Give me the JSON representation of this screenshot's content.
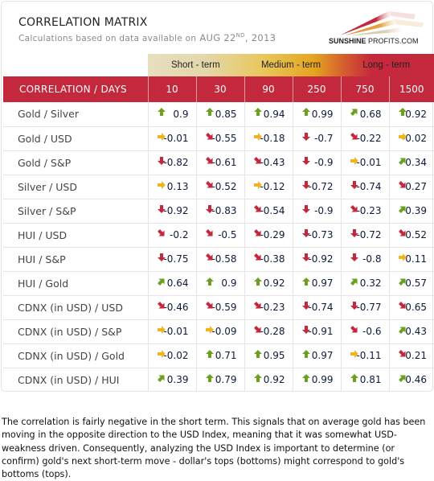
{
  "header": {
    "title": "CORRELATION MATRIX",
    "subtitle_prefix": "Calculations based on data available on",
    "date_month_day": "AUG 22",
    "date_suffix": "ND",
    "date_year": ", 2013",
    "logo_bold": "SUNSHINE",
    "logo_rest": " PROFITS.COM"
  },
  "colors": {
    "header_red": "#c3283c",
    "up": "#6aa21f",
    "flat": "#f0b323",
    "down": "#c3283c",
    "value_text": "#0d1a3a"
  },
  "terms": [
    "Short - term",
    "Medium - term",
    "Long - term"
  ],
  "chart_data": {
    "type": "table",
    "title": "CORRELATION MATRIX",
    "row_header": "CORRELATION / DAYS",
    "columns": [
      "10",
      "30",
      "90",
      "250",
      "750",
      "1500"
    ],
    "column_groups": [
      {
        "name": "Short - term",
        "columns": [
          "10",
          "30"
        ]
      },
      {
        "name": "Medium - term",
        "columns": [
          "90",
          "250"
        ]
      },
      {
        "name": "Long - term",
        "columns": [
          "750",
          "1500"
        ]
      }
    ],
    "rows": [
      {
        "label": "Gold / Silver",
        "values": [
          0.9,
          0.85,
          0.94,
          0.99,
          0.68,
          0.92
        ],
        "arrows": [
          "up",
          "up",
          "up",
          "up",
          "up-right",
          "up"
        ]
      },
      {
        "label": "Gold / USD",
        "values": [
          -0.01,
          -0.55,
          -0.18,
          -0.7,
          -0.22,
          -0.02
        ],
        "arrows": [
          "right",
          "down-right",
          "right",
          "down",
          "down-right",
          "right"
        ]
      },
      {
        "label": "Gold / S&P",
        "values": [
          -0.82,
          -0.61,
          -0.43,
          -0.9,
          -0.01,
          0.34
        ],
        "arrows": [
          "down",
          "down-right",
          "down-right",
          "down",
          "right",
          "up-right"
        ]
      },
      {
        "label": "Silver / USD",
        "values": [
          0.13,
          -0.52,
          -0.12,
          -0.72,
          -0.74,
          -0.27
        ],
        "arrows": [
          "right",
          "down-right",
          "right",
          "down",
          "down",
          "down-right"
        ]
      },
      {
        "label": "Silver / S&P",
        "values": [
          -0.92,
          -0.83,
          -0.54,
          -0.9,
          -0.23,
          0.39
        ],
        "arrows": [
          "down",
          "down",
          "down-right",
          "down",
          "down-right",
          "up-right"
        ]
      },
      {
        "label": "HUI / USD",
        "values": [
          -0.2,
          -0.5,
          -0.29,
          -0.73,
          -0.72,
          -0.52
        ],
        "arrows": [
          "down-right",
          "down-right",
          "down-right",
          "down",
          "down",
          "down-right"
        ]
      },
      {
        "label": "HUI / S&P",
        "values": [
          -0.75,
          -0.58,
          -0.38,
          -0.92,
          -0.8,
          0.11
        ],
        "arrows": [
          "down",
          "down-right",
          "down-right",
          "down",
          "down",
          "right"
        ]
      },
      {
        "label": "HUI / Gold",
        "values": [
          0.64,
          0.9,
          0.92,
          0.97,
          0.32,
          0.57
        ],
        "arrows": [
          "up-right",
          "up",
          "up",
          "up",
          "up-right",
          "up-right"
        ]
      },
      {
        "label": "CDNX (in USD) / USD",
        "values": [
          -0.46,
          -0.59,
          -0.23,
          -0.74,
          -0.77,
          -0.65
        ],
        "arrows": [
          "down-right",
          "down-right",
          "down-right",
          "down",
          "down",
          "down-right"
        ]
      },
      {
        "label": "CDNX (in USD) / S&P",
        "values": [
          -0.01,
          -0.09,
          -0.28,
          -0.91,
          -0.6,
          0.43
        ],
        "arrows": [
          "right",
          "right",
          "down-right",
          "down",
          "down-right",
          "up-right"
        ]
      },
      {
        "label": "CDNX (in USD) / Gold",
        "values": [
          -0.02,
          0.71,
          0.95,
          0.97,
          -0.11,
          -0.21
        ],
        "arrows": [
          "right",
          "up",
          "up",
          "up",
          "right",
          "down-right"
        ]
      },
      {
        "label": "CDNX (in USD) / HUI",
        "values": [
          0.39,
          0.79,
          0.92,
          0.99,
          0.81,
          0.46
        ],
        "arrows": [
          "up-right",
          "up",
          "up",
          "up",
          "up",
          "up-right"
        ]
      }
    ]
  },
  "note": "The correlation is fairly negative in the short term. This signals that on average gold has been moving in the opposite direction to the USD Index, meaning that it was somewhat USD-weakness driven. Consequently, analyzing the USD Index is important to determine (or confirm) gold's next short-term move - dollar's tops (bottoms) might correspond to gold's bottoms (tops)."
}
